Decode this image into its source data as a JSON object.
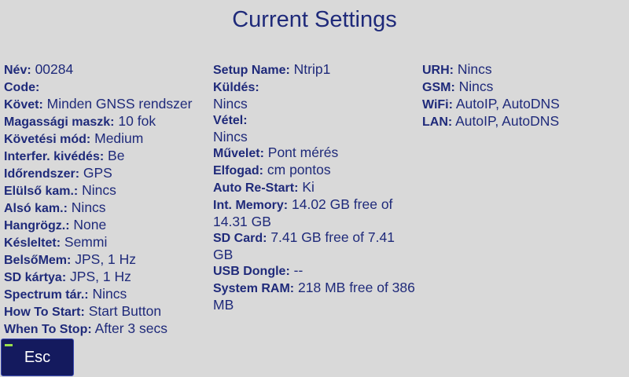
{
  "title": "Current Settings",
  "col1": [
    {
      "label": "Név:",
      "value": "00284"
    },
    {
      "label": "Code:",
      "value": ""
    },
    {
      "label": "Követ:",
      "value": "Minden GNSS rendszer"
    },
    {
      "label": "Magassági maszk:",
      "value": "10 fok"
    },
    {
      "label": "Követési mód:",
      "value": "Medium"
    },
    {
      "label": "Interfer. kivédés:",
      "value": "Be"
    },
    {
      "label": "Időrendszer:",
      "value": "GPS"
    },
    {
      "label": "Elülső kam.:",
      "value": "Nincs"
    },
    {
      "label": "Alsó kam.:",
      "value": "Nincs"
    },
    {
      "label": "Hangrögz.:",
      "value": "None"
    },
    {
      "label": "Késleltet:",
      "value": "Semmi"
    },
    {
      "label": "BelsőMem:",
      "value": "JPS, 1 Hz"
    },
    {
      "label": "SD kártya:",
      "value": "JPS, 1 Hz"
    },
    {
      "label": "Spectrum tár.:",
      "value": "Nincs"
    },
    {
      "label": "How To Start:",
      "value": "Start Button"
    },
    {
      "label": "When To Stop:",
      "value": "After 3 secs"
    }
  ],
  "col2": [
    {
      "label": "Setup Name:",
      "value": "Ntrip1"
    },
    {
      "label": "Küldés:",
      "value": "Nincs"
    },
    {
      "label": "Vétel:",
      "value": "Nincs"
    },
    {
      "label": "Művelet:",
      "value": "Pont mérés"
    },
    {
      "label": "Elfogad:",
      "value": "cm pontos"
    },
    {
      "label": "Auto Re-Start:",
      "value": "Ki"
    },
    {
      "label": "Int. Memory:",
      "value": "14.02 GB free of 14.31 GB"
    },
    {
      "label": "SD Card:",
      "value": "7.41 GB free of 7.41 GB"
    },
    {
      "label": "USB Dongle:",
      "value": "--"
    },
    {
      "label": "System RAM:",
      "value": "218 MB free of 386 MB"
    }
  ],
  "col3": [
    {
      "label": "URH:",
      "value": "Nincs"
    },
    {
      "label": "GSM:",
      "value": "Nincs"
    },
    {
      "label": "WiFi:",
      "value": "AutoIP, AutoDNS"
    },
    {
      "label": "LAN:",
      "value": "AutoIP, AutoDNS"
    }
  ],
  "esc_label": "Esc",
  "colors": {
    "background": "#d9d9d9",
    "text": "#1f2a7a",
    "button_bg": "#141a5e",
    "indicator": "#9ae04a"
  }
}
